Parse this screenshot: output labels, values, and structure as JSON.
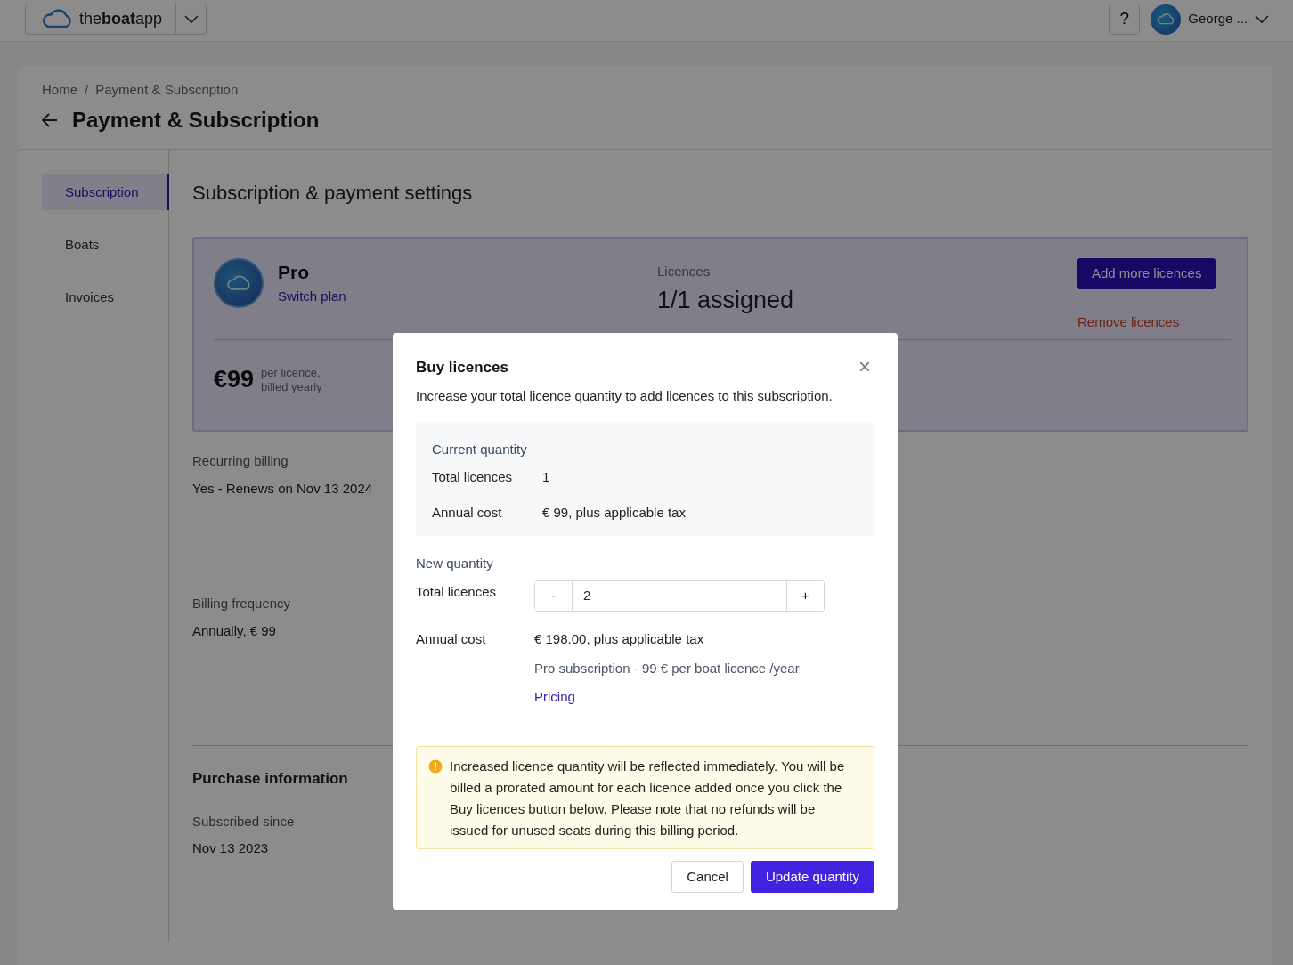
{
  "topbar": {
    "logo_text": "the**boat**app",
    "help": "?",
    "user_name": "George ..."
  },
  "breadcrumb": {
    "separator": "/",
    "items": [
      {
        "label": "Home"
      },
      {
        "label": "Payment & Subscription"
      }
    ]
  },
  "page_title": "Payment & Subscription",
  "sidebar": {
    "items": [
      {
        "label": "Subscription",
        "selected": true
      },
      {
        "label": "Boats",
        "selected": false
      },
      {
        "label": "Invoices",
        "selected": false
      }
    ]
  },
  "section_title": "Subscription & payment settings",
  "plan": {
    "name": "Pro",
    "switch_link": "Switch plan",
    "licences_label": "Licences",
    "licences_value": "1/1 assigned",
    "add_button": "Add more licences",
    "remove_link": "Remove licences",
    "price": "€99",
    "price_note": [
      "per licence,",
      "billed yearly"
    ]
  },
  "details": [
    {
      "label": "Recurring billing",
      "value": "Yes - Renews on Nov 13 2024"
    },
    {
      "label": "Billing frequency",
      "value": "Annually, € 99"
    }
  ],
  "purchase": {
    "title": "Purchase information",
    "fields": [
      {
        "label": "Subscribed since",
        "value": "Nov 13 2023"
      }
    ]
  },
  "modal": {
    "title": "Buy licences",
    "close": "×",
    "description": "Increase your total licence quantity to add licences to this subscription.",
    "current": {
      "title": "Current quantity",
      "rows": [
        {
          "label": "Total licences",
          "value": "1"
        },
        {
          "label": "Annual cost",
          "value": "€ 99, plus applicable tax"
        }
      ]
    },
    "new": {
      "title": "New quantity",
      "label": "Total licences",
      "minus": "-",
      "value": "2",
      "plus": "+",
      "cost_label": "Annual cost",
      "cost_value": "€ 198.00, plus applicable tax",
      "note": "Pro subscription - 99 € per boat licence /year",
      "pricing_link": "Pricing"
    },
    "warning": "Increased licence quantity will be reflected immediately. You will be billed a prorated amount for each licence added once you click the Buy licences button below. Please note that no refunds will be issued for unused seats during this billing period.",
    "cancel": "Cancel",
    "confirm": "Update quantity"
  }
}
